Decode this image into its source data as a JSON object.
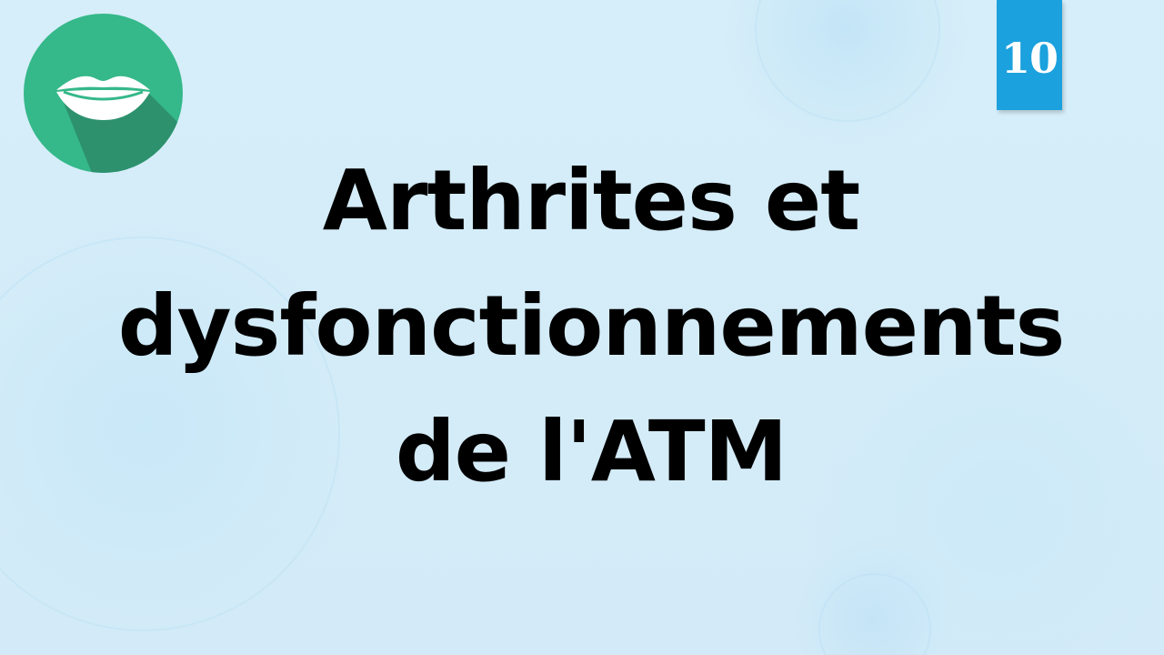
{
  "slide": {
    "page_number": "10",
    "title_lines": [
      "Arthrites et",
      "dysfonctionnements",
      "de l'ATM"
    ]
  },
  "logo": {
    "icon": "smile-lips-icon",
    "circle_color": "#35b88a",
    "shadow_color": "#2c8a68",
    "smile_color": "#ffffff"
  },
  "colors": {
    "background": "#d4ecf8",
    "badge": "#1ba1dd",
    "title_text": "#000000"
  }
}
